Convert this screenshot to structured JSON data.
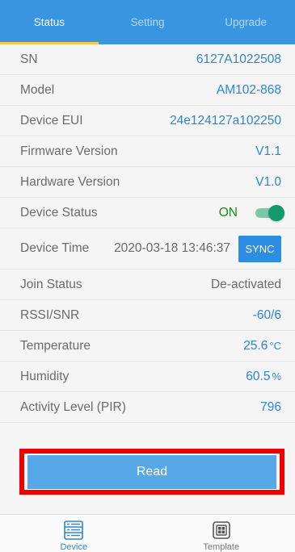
{
  "tabs": [
    {
      "label": "Status",
      "active": true
    },
    {
      "label": "Setting",
      "active": false
    },
    {
      "label": "Upgrade",
      "active": false
    }
  ],
  "rows": {
    "sn": {
      "label": "SN",
      "value": "6127A1022508"
    },
    "model": {
      "label": "Model",
      "value": "AM102-868"
    },
    "eui": {
      "label": "Device EUI",
      "value": "24e124127a102250"
    },
    "fw": {
      "label": "Firmware Version",
      "value": "V1.1"
    },
    "hw": {
      "label": "Hardware Version",
      "value": "V1.0"
    },
    "status": {
      "label": "Device Status",
      "value": "ON",
      "toggle_on": true
    },
    "time": {
      "label": "Device Time",
      "value": "2020-03-18 13:46:37",
      "button": "SYNC"
    },
    "join": {
      "label": "Join Status",
      "value": "De-activated"
    },
    "rssi": {
      "label": "RSSI/SNR",
      "value": "-60/6"
    },
    "temp": {
      "label": "Temperature",
      "value": "25.6",
      "unit": "°C"
    },
    "humidity": {
      "label": "Humidity",
      "value": "60.5",
      "unit": "%"
    },
    "pir": {
      "label": "Activity Level (PIR)",
      "value": "796"
    }
  },
  "read_button": "Read",
  "bottom_nav": [
    {
      "label": "Device",
      "icon": "device-list-icon",
      "active": true
    },
    {
      "label": "Template",
      "icon": "template-icon",
      "active": false
    }
  ],
  "colors": {
    "header": "#3a95e0",
    "accent": "#2f86cf",
    "tab_indicator": "#f7c948",
    "highlight": "#ee0000",
    "status_on": "#119211"
  }
}
